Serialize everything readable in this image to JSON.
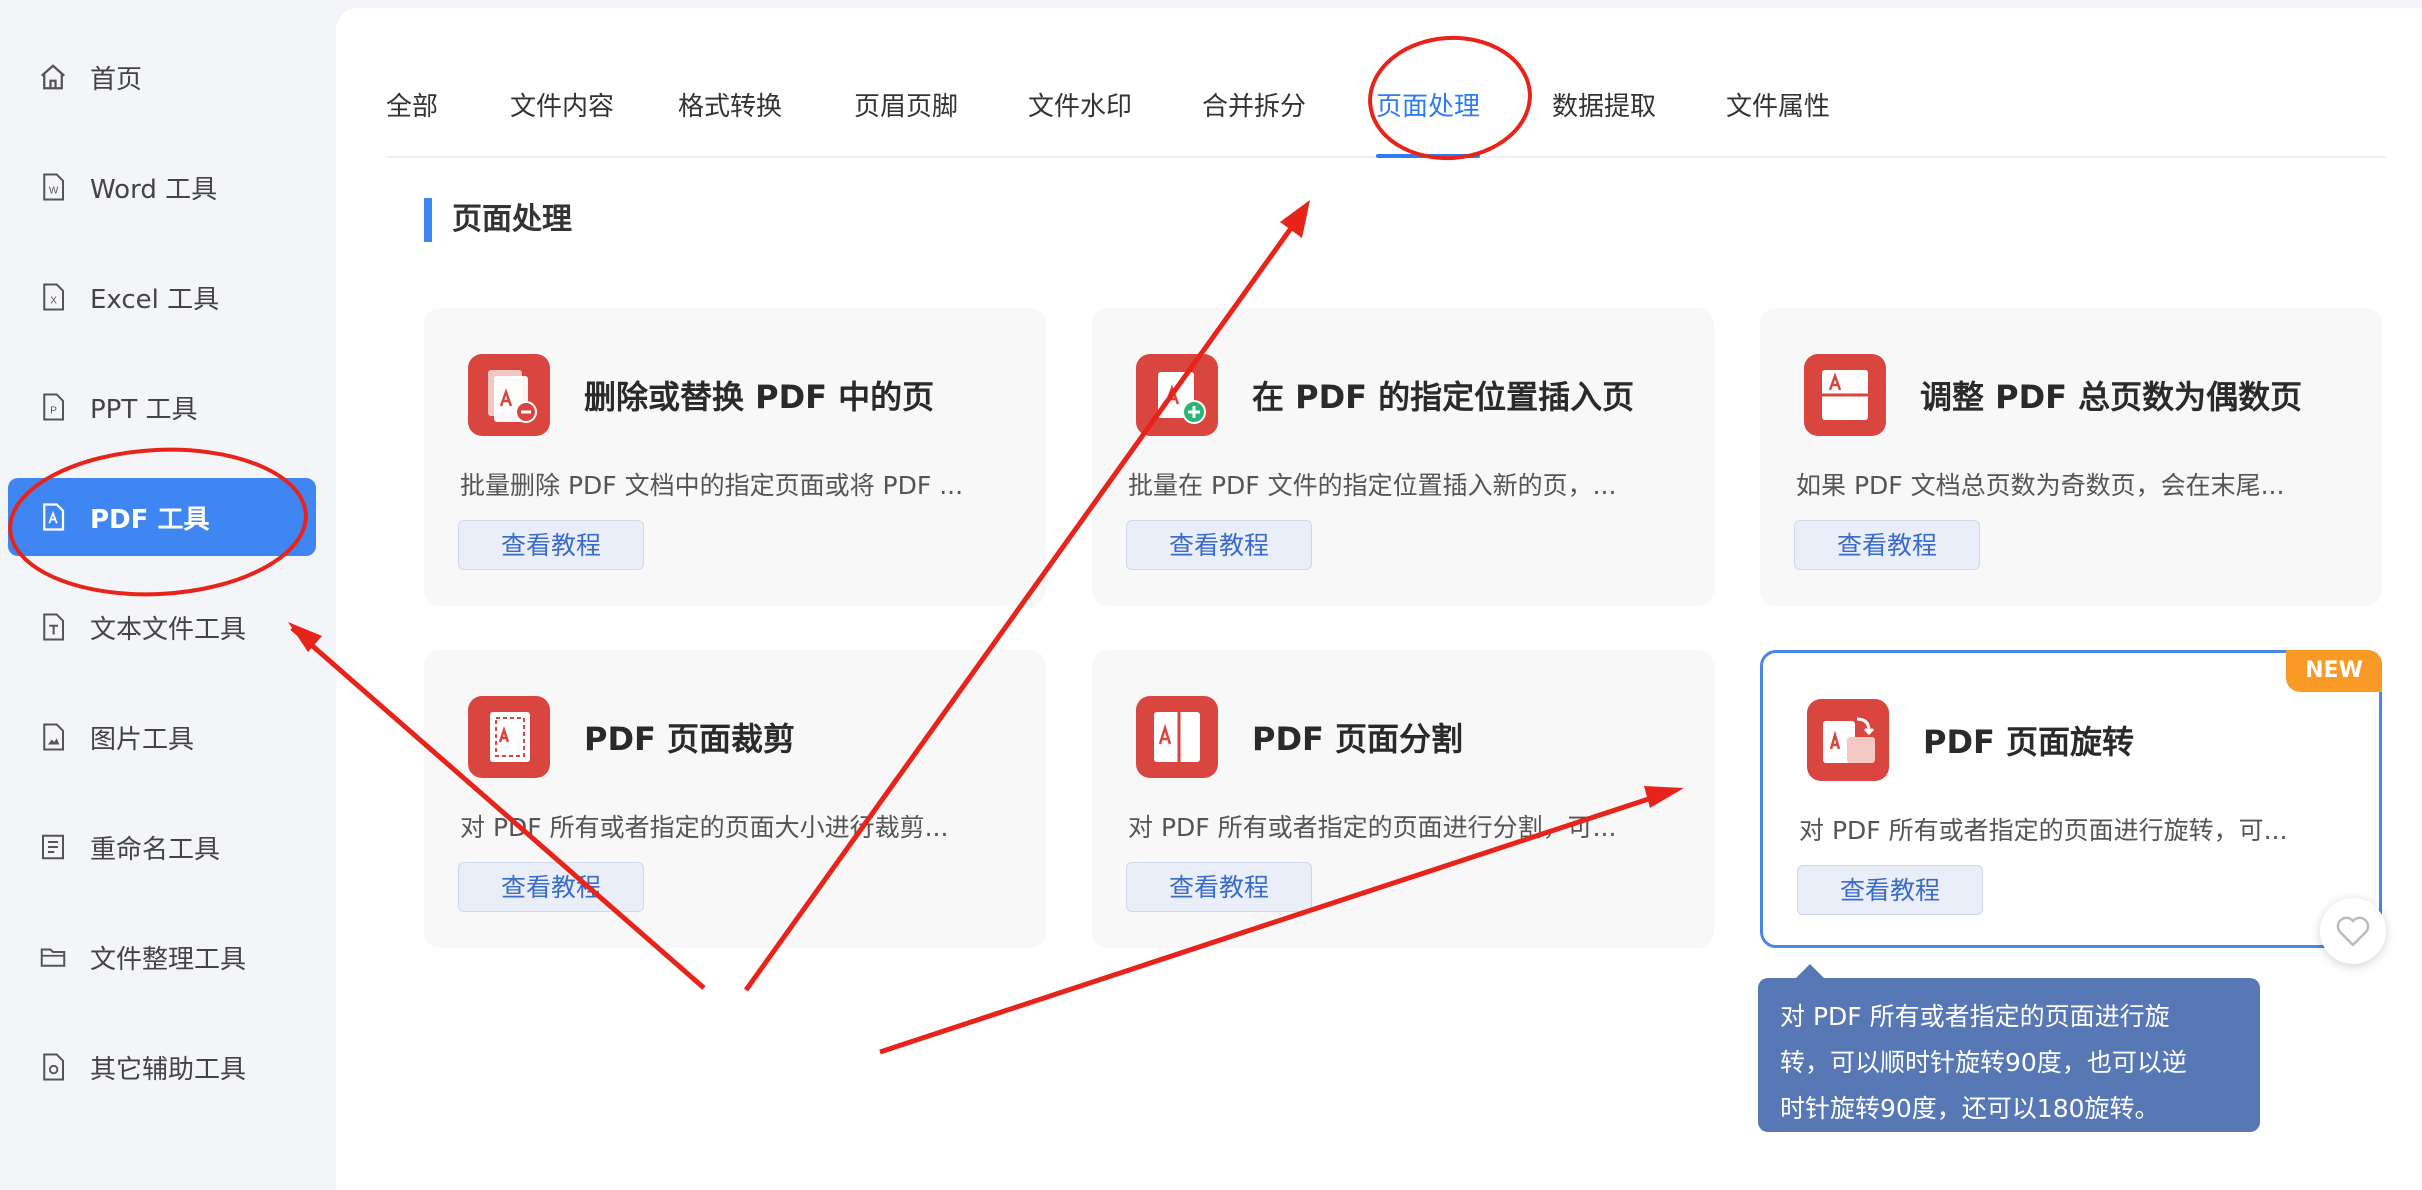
{
  "sidebar": {
    "items": [
      {
        "label": "首页",
        "icon": "home-icon"
      },
      {
        "label": "Word 工具",
        "icon": "word-file-icon"
      },
      {
        "label": "Excel 工具",
        "icon": "excel-file-icon"
      },
      {
        "label": "PPT 工具",
        "icon": "ppt-file-icon"
      },
      {
        "label": "PDF 工具",
        "icon": "pdf-file-icon",
        "active": true
      },
      {
        "label": "文本文件工具",
        "icon": "text-file-icon"
      },
      {
        "label": "图片工具",
        "icon": "image-file-icon"
      },
      {
        "label": "重命名工具",
        "icon": "rename-icon"
      },
      {
        "label": "文件整理工具",
        "icon": "folder-icon"
      },
      {
        "label": "其它辅助工具",
        "icon": "misc-file-icon"
      }
    ]
  },
  "tabs": [
    {
      "label": "全部"
    },
    {
      "label": "文件内容"
    },
    {
      "label": "格式转换"
    },
    {
      "label": "页眉页脚"
    },
    {
      "label": "文件水印"
    },
    {
      "label": "合并拆分"
    },
    {
      "label": "页面处理",
      "active": true
    },
    {
      "label": "数据提取"
    },
    {
      "label": "文件属性"
    }
  ],
  "section": {
    "title": "页面处理"
  },
  "cards": [
    {
      "title": "删除或替换 PDF 中的页",
      "desc": "批量删除 PDF 文档中的指定页面或将 PDF ...",
      "button": "查看教程",
      "icon": "pdf-delete-page-icon"
    },
    {
      "title": "在 PDF 的指定位置插入页",
      "desc": "批量在 PDF 文件的指定位置插入新的页，...",
      "button": "查看教程",
      "icon": "pdf-insert-page-icon"
    },
    {
      "title": "调整 PDF 总页数为偶数页",
      "desc": "如果 PDF 文档总页数为奇数页，会在末尾...",
      "button": "查看教程",
      "icon": "pdf-even-pages-icon"
    },
    {
      "title": "PDF 页面裁剪",
      "desc": "对 PDF 所有或者指定的页面大小进行裁剪...",
      "button": "查看教程",
      "icon": "pdf-crop-icon"
    },
    {
      "title": "PDF 页面分割",
      "desc": "对 PDF 所有或者指定的页面进行分割，可...",
      "button": "查看教程",
      "icon": "pdf-split-page-icon"
    },
    {
      "title": "PDF 页面旋转",
      "desc": "对 PDF 所有或者指定的页面进行旋转，可...",
      "button": "查看教程",
      "icon": "pdf-rotate-icon",
      "badge": "NEW"
    }
  ],
  "tooltip": {
    "lines": [
      "对 PDF 所有或者指定的页面进行旋",
      "转，可以顺时针旋转90度，也可以逆",
      "时针旋转90度，还可以180旋转。"
    ]
  },
  "colors": {
    "accent": "#3f86f2",
    "pdf_red": "#d8463f",
    "badge_orange": "#f89a25",
    "annotation_red": "#e8231a",
    "tooltip_bg": "#5778b4"
  }
}
